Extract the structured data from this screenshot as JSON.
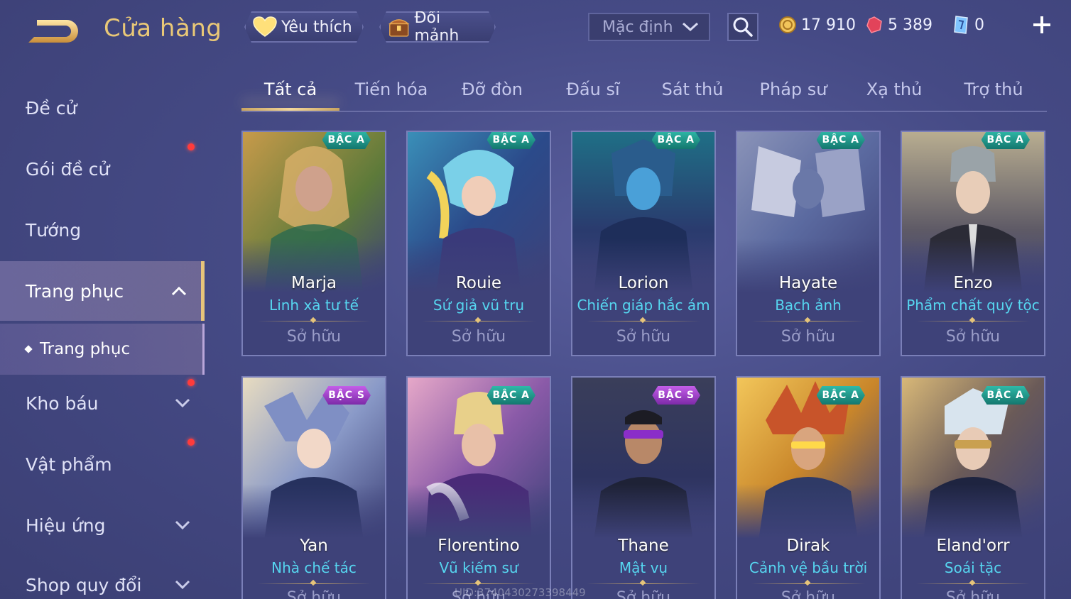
{
  "header": {
    "title": "Cửa hàng",
    "favorite_label": "Yêu thích",
    "exchange_label": "Đổi mảnh",
    "sort_value": "Mặc định",
    "currencies": [
      {
        "icon": "gold-coin-icon",
        "value": "17 910"
      },
      {
        "icon": "ruby-icon",
        "value": "5 389"
      },
      {
        "icon": "voucher-icon",
        "value": "0"
      }
    ]
  },
  "sidebar": {
    "items": [
      {
        "label": "Đề cử"
      },
      {
        "label": "Gói đề cử"
      },
      {
        "label": "Tướng"
      },
      {
        "label": "Trang phục"
      },
      {
        "label": "Trang phục"
      },
      {
        "label": "Kho báu"
      },
      {
        "label": "Vật phẩm"
      },
      {
        "label": "Hiệu ứng"
      },
      {
        "label": "Shop quy đổi"
      }
    ]
  },
  "tabs": [
    "Tất cả",
    "Tiến hóa",
    "Đỡ đòn",
    "Đấu sĩ",
    "Sát thủ",
    "Pháp sư",
    "Xạ thủ",
    "Trợ thủ"
  ],
  "cards": [
    {
      "name": "Marja",
      "skin": "Linh xà tư tế",
      "badge": "BẬC A",
      "status": "Sở hữu"
    },
    {
      "name": "Rouie",
      "skin": "Sứ giả vũ trụ",
      "badge": "BẬC A",
      "status": "Sở hữu"
    },
    {
      "name": "Lorion",
      "skin": "Chiến giáp hắc ám",
      "badge": "BẬC A",
      "status": "Sở hữu"
    },
    {
      "name": "Hayate",
      "skin": "Bạch ảnh",
      "badge": "BẬC A",
      "status": "Sở hữu"
    },
    {
      "name": "Enzo",
      "skin": "Phẩm chất quý tộc",
      "badge": "BẬC A",
      "status": "Sở hữu"
    },
    {
      "name": "Yan",
      "skin": "Nhà chế tác",
      "badge": "BẬC S",
      "status": "Sở hữu"
    },
    {
      "name": "Florentino",
      "skin": "Vũ kiếm sư",
      "badge": "BẬC A",
      "status": "Sở hữu"
    },
    {
      "name": "Thane",
      "skin": "Mật vụ",
      "badge": "BẬC S",
      "status": "Sở hữu"
    },
    {
      "name": "Dirak",
      "skin": "Cảnh vệ bầu trời",
      "badge": "BẬC A",
      "status": "Sở hữu"
    },
    {
      "name": "Eland'orr",
      "skin": "Soái tặc",
      "badge": "BẬC A",
      "status": "Sở hữu"
    }
  ],
  "watermark": "UID:3740430273398449",
  "colors": {
    "accent_gold": "#e9c877",
    "skin_name": "#56d6f0",
    "badge_a": "#14776e",
    "badge_s": "#7d2aa8",
    "alert_dot": "#ff3b3b"
  }
}
